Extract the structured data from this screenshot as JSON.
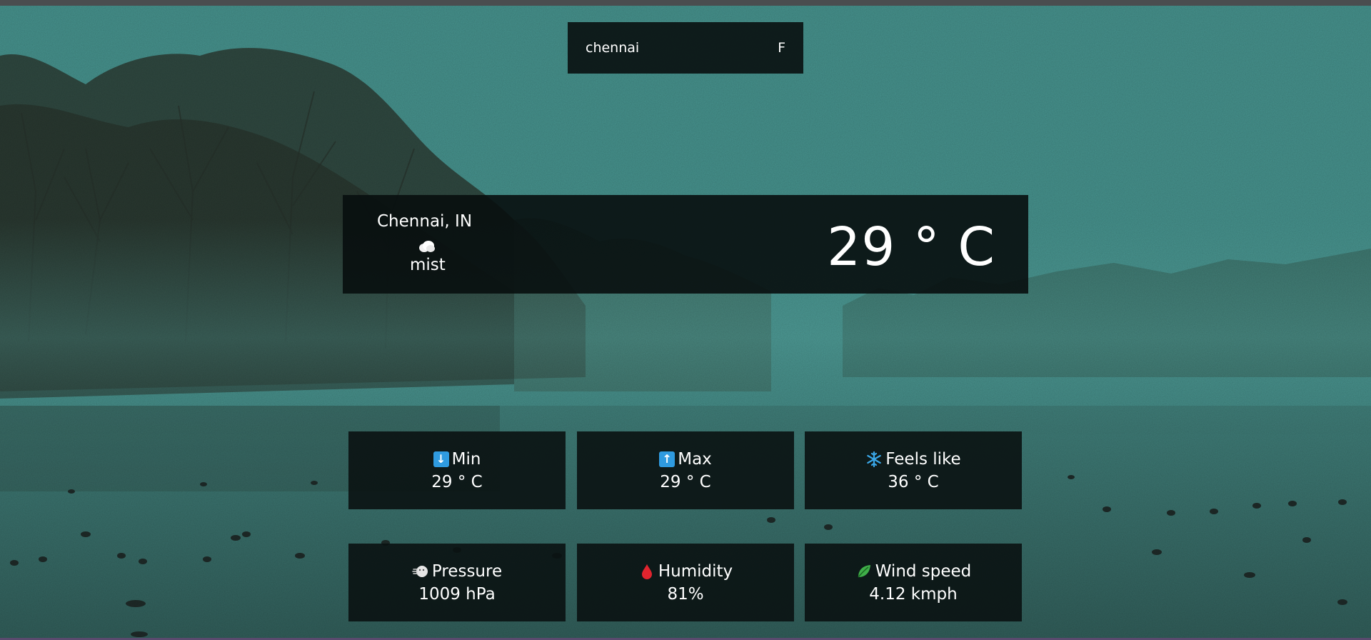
{
  "search": {
    "value": "chennai",
    "unit_toggle_label": "F"
  },
  "current": {
    "location": "Chennai, IN",
    "condition_icon": "cloud-icon",
    "condition": "mist",
    "temperature": "29 ° C"
  },
  "stats": [
    {
      "label": "Min",
      "value": "29 ° C",
      "icon": "arrow-down-icon"
    },
    {
      "label": "Max",
      "value": "29 ° C",
      "icon": "arrow-up-icon"
    },
    {
      "label": "Feels like",
      "value": "36 ° C",
      "icon": "snowflake-icon"
    },
    {
      "label": "Pressure",
      "value": "1009 hPa",
      "icon": "wind-face-icon"
    },
    {
      "label": "Humidity",
      "value": "81%",
      "icon": "droplet-icon"
    },
    {
      "label": "Wind speed",
      "value": "4.12 kmph",
      "icon": "leaf-icon"
    }
  ],
  "colors": {
    "arrow_icon_bg": "#2f9be0",
    "snowflake": "#3aa6e6",
    "droplet": "#e0242e",
    "leaf": "#3fae49",
    "panel_bg": "#0a1212"
  }
}
